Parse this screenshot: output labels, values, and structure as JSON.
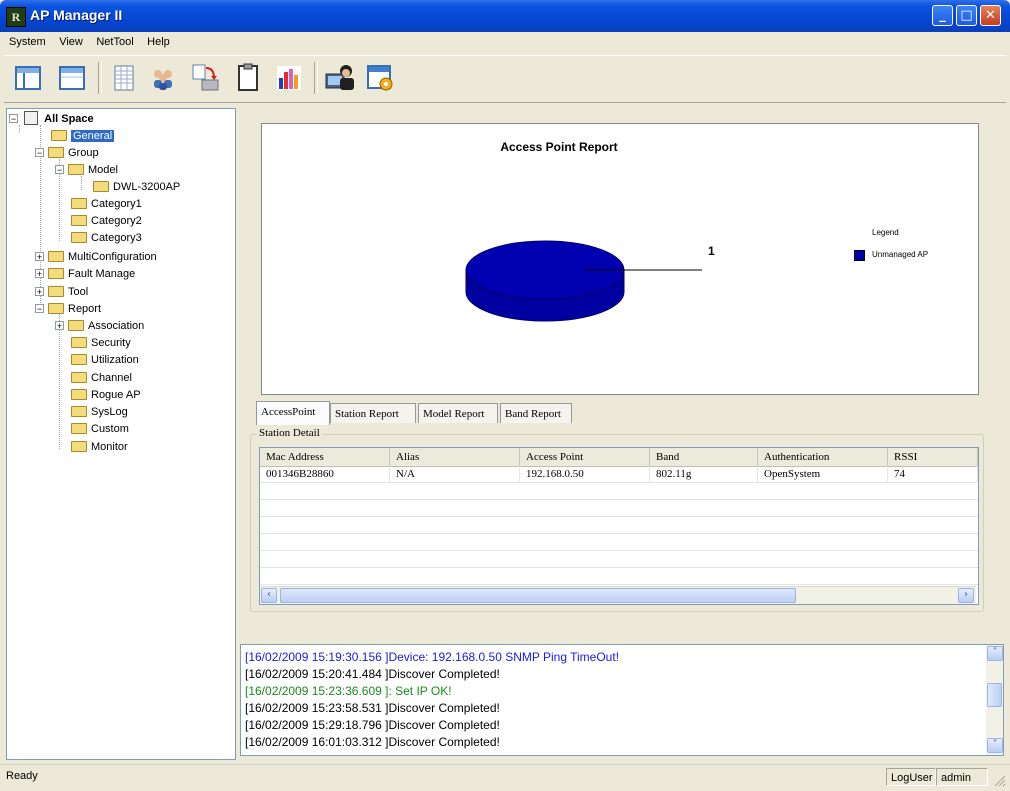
{
  "window": {
    "title": "AP Manager II",
    "icon_text": "R"
  },
  "menu": [
    "System",
    "View",
    "NetTool",
    "Help"
  ],
  "toolbar": {
    "icons": [
      "layout-left-icon",
      "layout-window-icon",
      "table-icon",
      "users-icon",
      "transfer-icon",
      "clipboard-icon",
      "bar-chart-icon",
      "user-computer-icon",
      "settings-window-icon"
    ]
  },
  "tree": {
    "items": [
      {
        "label": "All Space"
      },
      {
        "label": "General"
      },
      {
        "label": "Group"
      },
      {
        "label": "Model"
      },
      {
        "label": "DWL-3200AP"
      },
      {
        "label": "Category1"
      },
      {
        "label": "Category2"
      },
      {
        "label": "Category3"
      },
      {
        "label": "MultiConfiguration"
      },
      {
        "label": "Fault Manage"
      },
      {
        "label": "Tool"
      },
      {
        "label": "Report"
      },
      {
        "label": "Association"
      },
      {
        "label": "Security"
      },
      {
        "label": "Utilization"
      },
      {
        "label": "Channel"
      },
      {
        "label": "Rogue AP"
      },
      {
        "label": "SysLog"
      },
      {
        "label": "Custom"
      },
      {
        "label": "Monitor"
      }
    ],
    "selected": "General"
  },
  "chart_data": {
    "type": "pie",
    "title": "Access Point Report",
    "categories": [
      "Unmanaged AP"
    ],
    "values": [
      1
    ],
    "data_labels": [
      "1"
    ],
    "legend": {
      "title": "Legend",
      "placement": "right"
    },
    "colors": [
      "#0000b0"
    ]
  },
  "tabs": [
    "AccessPoint",
    "Station Report",
    "Model Report",
    "Band Report"
  ],
  "active_tab": "AccessPoint",
  "station_detail": {
    "title": "Station Detail",
    "columns": [
      "Mac Address",
      "Alias",
      "Access Point",
      "Band",
      "Authentication",
      "RSSI"
    ],
    "rows": [
      [
        "001346B28860",
        "N/A",
        "192.168.0.50",
        "802.11g",
        "OpenSystem",
        "74"
      ]
    ]
  },
  "log": [
    {
      "text": "[16/02/2009 15:19:30.156 ]Device: 192.168.0.50 SNMP Ping TimeOut!",
      "color": "#1a1ae6"
    },
    {
      "text": "[16/02/2009 15:20:41.484 ]Discover Completed!",
      "color": "#000000"
    },
    {
      "text": "[16/02/2009 15:23:36.609 ]: Set IP  OK!",
      "color": "#1a8a1a"
    },
    {
      "text": "[16/02/2009 15:23:58.531 ]Discover Completed!",
      "color": "#000000"
    },
    {
      "text": "[16/02/2009 15:29:18.796 ]Discover Completed!",
      "color": "#000000"
    },
    {
      "text": "[16/02/2009 16:01:03.312 ]Discover Completed!",
      "color": "#000000"
    }
  ],
  "status": {
    "ready": "Ready",
    "user_label": "LogUser",
    "user_value": "admin"
  }
}
